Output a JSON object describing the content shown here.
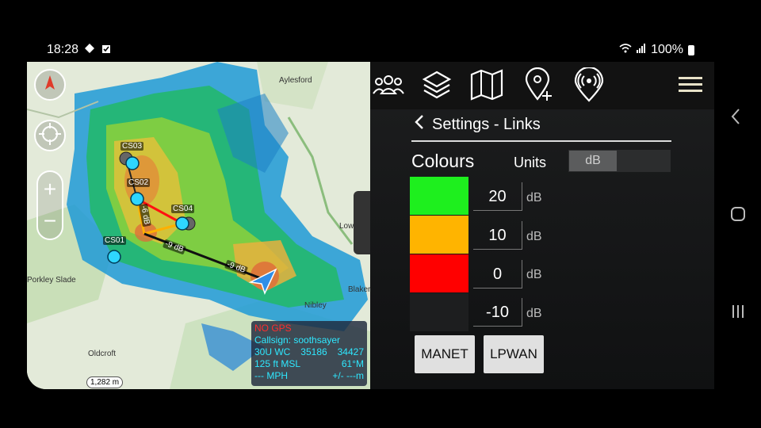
{
  "status_bar": {
    "time": "18:28",
    "battery": "100%"
  },
  "map": {
    "nodes": [
      {
        "label": "CS03"
      },
      {
        "label": "CS02"
      },
      {
        "label": "CS04"
      },
      {
        "label": "CS01"
      }
    ],
    "links": [
      {
        "label": "-6 dB"
      },
      {
        "label": "-9 dB"
      },
      {
        "label": "-9 dB"
      }
    ],
    "places": [
      "Aylesford",
      "Lowfield",
      "Blaker",
      "Nibley",
      "Porkley Slade",
      "Oldcroft"
    ],
    "scale_label": "1,282 m",
    "info_panel": {
      "gps_status": "NO GPS",
      "callsign": "Callsign: soothsayer",
      "grid_prefix": "30U  WC",
      "grid_easting": "35186",
      "grid_northing": "34427",
      "altitude": "125 ft MSL",
      "heading": "61°M",
      "speed": "--- MPH",
      "accuracy": "+/- ---m"
    }
  },
  "toolbar": {
    "icons": [
      "team-icon",
      "layers-icon",
      "map-icon",
      "add-marker-icon",
      "radio-broadcast-icon",
      "menu-icon"
    ]
  },
  "settings": {
    "title": "Settings - Links",
    "colours_label": "Colours",
    "units_label": "Units",
    "units_value": "dB",
    "thresholds": [
      {
        "color": "#1eef1e",
        "value": "20",
        "unit": "dB"
      },
      {
        "color": "#ffb400",
        "value": "10",
        "unit": "dB"
      },
      {
        "color": "#ff0000",
        "value": "0",
        "unit": "dB"
      },
      {
        "color": "#1d1e1f",
        "value": "-10",
        "unit": "dB"
      }
    ],
    "buttons": {
      "manet": "MANET",
      "lpwan": "LPWAN"
    }
  }
}
